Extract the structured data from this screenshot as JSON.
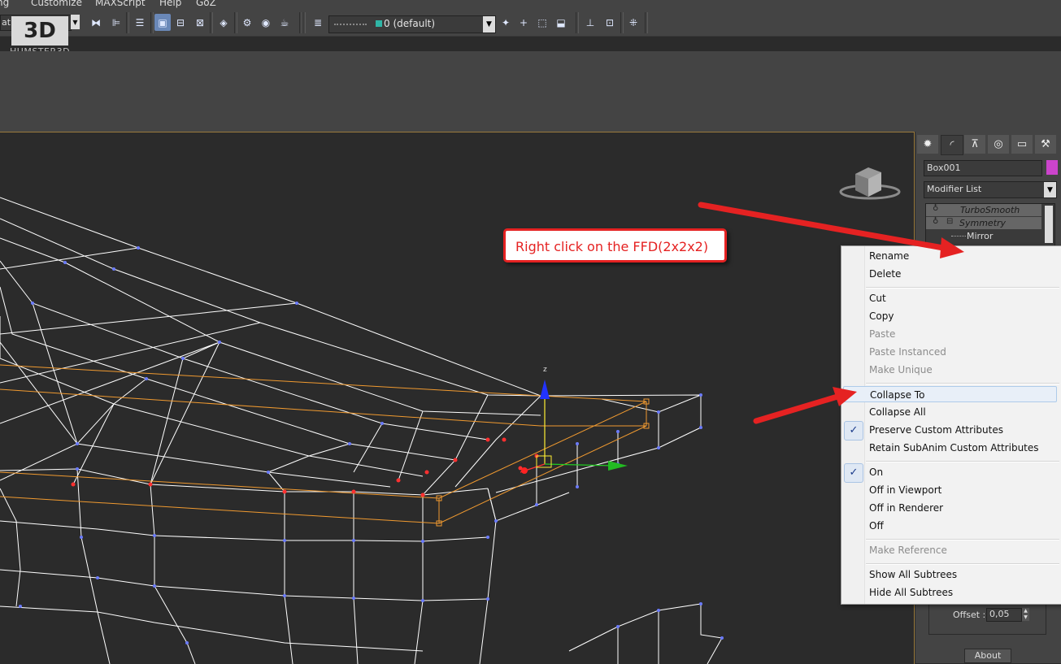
{
  "menubar": {
    "items": [
      "ng",
      "Customize",
      "MAXScript",
      "Help",
      "GoZ"
    ]
  },
  "logo": {
    "mark": "3D",
    "text": "HUMSTER3D"
  },
  "toolbar": {
    "small_dropdown_label": "at",
    "layer_value": "0 (default)",
    "layer_swatch_color": "#2fb5a6",
    "icons": [
      "mirror-icon",
      "align-icon",
      "layer-manager-icon",
      "graphite-toggle-icon",
      "curve-editor-icon",
      "schematic-view-icon",
      "material-editor-icon",
      "render-setup-icon",
      "rendered-frame-icon",
      "render-icon",
      "layer-icon",
      "create-layer-icon",
      "add-to-layer-icon",
      "select-in-layer-icon",
      "set-current-layer-icon",
      "sweep-icon",
      "measure-icon",
      "snaps-icon"
    ]
  },
  "command_panel": {
    "tabs": [
      "create-tab",
      "modify-tab",
      "hierarchy-tab",
      "motion-tab",
      "display-tab",
      "utilities-tab"
    ],
    "object_name": "Box001",
    "object_color": "#cc44cc",
    "modifier_list_label": "Modifier List",
    "stack": [
      {
        "label": "TurboSmooth"
      },
      {
        "label": "Symmetry"
      },
      {
        "label": "Mirror"
      }
    ],
    "offset_label": "Offset :",
    "offset_value": "0,05",
    "about_label": "About"
  },
  "viewport": {
    "gizmo_axis_label": "z",
    "mesh_color": "#ffffff",
    "ffd_color": "#f09a30"
  },
  "callout": {
    "text": "Right click on the FFD(2x2x2)"
  },
  "context_menu": {
    "group1": [
      "Rename",
      "Delete"
    ],
    "group2": [
      {
        "label": "Cut",
        "enabled": true
      },
      {
        "label": "Copy",
        "enabled": true
      },
      {
        "label": "Paste",
        "enabled": false
      },
      {
        "label": "Paste Instanced",
        "enabled": false
      },
      {
        "label": "Make Unique",
        "enabled": false
      }
    ],
    "group3": [
      {
        "label": "Collapse To",
        "highlighted": true,
        "checked": false
      },
      {
        "label": "Collapse All",
        "highlighted": false,
        "checked": false
      },
      {
        "label": "Preserve Custom Attributes",
        "highlighted": false,
        "checked": true
      },
      {
        "label": "Retain SubAnim Custom Attributes",
        "highlighted": false,
        "checked": false
      }
    ],
    "group4": [
      {
        "label": "On",
        "checked": true
      },
      {
        "label": "Off in Viewport",
        "checked": false
      },
      {
        "label": "Off in Renderer",
        "checked": false
      },
      {
        "label": "Off",
        "checked": false
      }
    ],
    "group5": [
      {
        "label": "Make Reference",
        "enabled": false
      }
    ],
    "group6": [
      "Show All Subtrees",
      "Hide All Subtrees"
    ]
  },
  "annotation_color": "#e52222"
}
